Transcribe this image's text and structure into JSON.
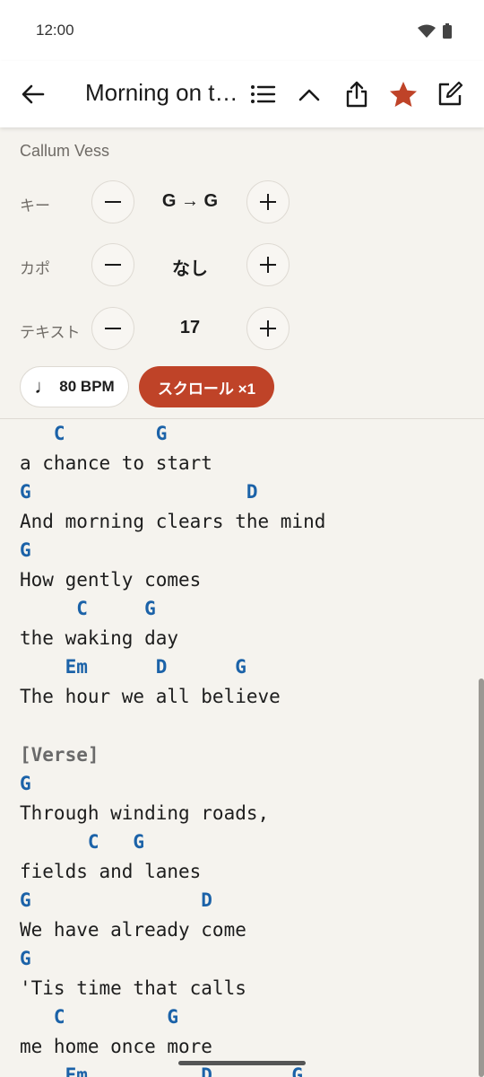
{
  "status_bar": {
    "time": "12:00"
  },
  "app_bar": {
    "title": "Morning on the Hill"
  },
  "artist": "Callum Vess",
  "controls": {
    "key": {
      "label": "キー",
      "value": "G → G"
    },
    "capo": {
      "label": "カポ",
      "value": "なし"
    },
    "text": {
      "label": "テキスト",
      "value": "17"
    }
  },
  "chips": {
    "bpm": "80 BPM",
    "scroll": "スクロール ×1"
  },
  "sheet": [
    {
      "type": "chord",
      "text": "   C        G"
    },
    {
      "type": "lyric",
      "text": "a chance to start"
    },
    {
      "type": "chord",
      "text": "G                   D"
    },
    {
      "type": "lyric",
      "text": "And morning clears the mind"
    },
    {
      "type": "chord",
      "text": "G"
    },
    {
      "type": "lyric",
      "text": "How gently comes"
    },
    {
      "type": "chord",
      "text": "     C     G"
    },
    {
      "type": "lyric",
      "text": "the waking day"
    },
    {
      "type": "chord",
      "text": "    Em      D      G"
    },
    {
      "type": "lyric",
      "text": "The hour we all believe"
    },
    {
      "type": "blank",
      "text": ""
    },
    {
      "type": "section",
      "text": "[Verse]"
    },
    {
      "type": "chord",
      "text": "G"
    },
    {
      "type": "lyric",
      "text": "Through winding roads,"
    },
    {
      "type": "chord",
      "text": "      C   G"
    },
    {
      "type": "lyric",
      "text": "fields and lanes"
    },
    {
      "type": "chord",
      "text": "G               D"
    },
    {
      "type": "lyric",
      "text": "We have already come"
    },
    {
      "type": "chord",
      "text": "G"
    },
    {
      "type": "lyric",
      "text": "'Tis time that calls"
    },
    {
      "type": "chord",
      "text": "   C         G"
    },
    {
      "type": "lyric",
      "text": "me home once more"
    },
    {
      "type": "chord",
      "text": "    Em          D       G"
    }
  ],
  "colors": {
    "accent": "#bf4328",
    "chord": "#1b62a8",
    "background": "#f5f3ee"
  },
  "icons": [
    "back-arrow-icon",
    "list-icon",
    "chevron-up-icon",
    "share-icon",
    "star-icon",
    "edit-icon",
    "wifi-icon",
    "battery-icon",
    "minus-icon",
    "plus-icon",
    "music-note-icon"
  ]
}
